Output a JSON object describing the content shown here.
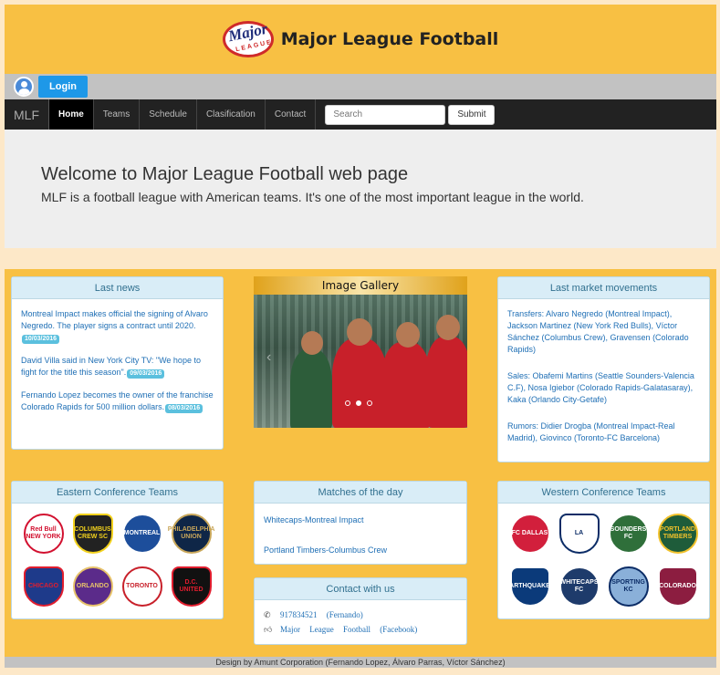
{
  "header": {
    "title": "Major League Football",
    "logo_word": "Major",
    "logo_sub": "LEAGUE"
  },
  "loginbar": {
    "login_label": "Login"
  },
  "nav": {
    "brand": "MLF",
    "items": [
      {
        "label": "Home",
        "active": true
      },
      {
        "label": "Teams"
      },
      {
        "label": "Schedule"
      },
      {
        "label": "Clasification"
      },
      {
        "label": "Contact"
      }
    ],
    "search_placeholder": "Search",
    "submit_label": "Submit"
  },
  "jumbotron": {
    "heading": "Welcome to Major League Football web page",
    "text": "MLF is a football league with American teams. It's one of the most important league in the world."
  },
  "last_news": {
    "title": "Last news",
    "items": [
      {
        "text": "Montreal Impact makes official the signing of Alvaro Negredo. The player signs a contract until 2020.",
        "date": "10/03/2016"
      },
      {
        "text": "David Villa said in New York City TV: \"We hope to fight for the title this season\".",
        "date": "09/03/2016"
      },
      {
        "text": "Fernando Lopez becomes the owner of the franchise Colorado Rapids for 500 million dollars.",
        "date": "08/03/2016"
      }
    ]
  },
  "gallery": {
    "title": "Image Gallery",
    "slides": 3,
    "active_slide": 2
  },
  "market": {
    "title": "Last market movements",
    "items": [
      "Transfers: Alvaro Negredo (Montreal Impact), Jackson Martinez (New York Red Bulls), Víctor Sánchez (Columbus Crew), Gravensen (Colorado Rapids)",
      "Sales: Obafemi Martins (Seattle Sounders-Valencia C.F), Nosa Igiebor (Colorado Rapids-Galatasaray), Kaka (Orlando City-Getafe)",
      "Rumors: Didier Drogba (Montreal Impact-Real Madrid), Giovinco (Toronto-FC Barcelona)"
    ]
  },
  "eastern": {
    "title": "Eastern Conference Teams",
    "teams": [
      {
        "name": "Red Bulls",
        "label": "Red Bull NEW YORK",
        "color": "#ffffff",
        "text": "#d2102f"
      },
      {
        "name": "Columbus Crew",
        "label": "COLUMBUS CREW SC",
        "color": "#222222",
        "text": "#f3d21d"
      },
      {
        "name": "Montreal Impact",
        "label": "MONTREAL",
        "color": "#1d4e9b",
        "text": "#ffffff"
      },
      {
        "name": "Philadelphia Union",
        "label": "PHILADELPHIA UNION",
        "color": "#0f2647",
        "text": "#c9a75a"
      },
      {
        "name": "Chicago Fire",
        "label": "CHICAGO",
        "color": "#1e3a8a",
        "text": "#e11d2e"
      },
      {
        "name": "Orlando City",
        "label": "ORLANDO",
        "color": "#5b2b8a",
        "text": "#e7c26a"
      },
      {
        "name": "Toronto FC",
        "label": "TORONTO",
        "color": "#ffffff",
        "text": "#c8202a"
      },
      {
        "name": "DC United",
        "label": "D.C. UNITED",
        "color": "#111111",
        "text": "#e11d2e"
      }
    ]
  },
  "matches": {
    "title": "Matches of the day",
    "items": [
      "Whitecaps-Montreal Impact",
      "Portland Timbers-Columbus Crew"
    ]
  },
  "contact": {
    "title": "Contact with us",
    "phone": "917834521   (Fernando)",
    "facebook": "Major League Football (Facebook)"
  },
  "western": {
    "title": "Western Conference Teams",
    "teams": [
      {
        "name": "FC Dallas",
        "label": "FC DALLAS",
        "color": "#d21f3c",
        "text": "#ffffff"
      },
      {
        "name": "LA Galaxy",
        "label": "LA",
        "color": "#ffffff",
        "text": "#0b2c66"
      },
      {
        "name": "Seattle Sounders",
        "label": "SOUNDERS FC",
        "color": "#2f6f3a",
        "text": "#ffffff"
      },
      {
        "name": "Portland Timbers",
        "label": "PORTLAND TIMBERS",
        "color": "#1e5c3a",
        "text": "#f1c12b"
      },
      {
        "name": "San Jose Earthquakes",
        "label": "EARTHQUAKES",
        "color": "#0b3a7a",
        "text": "#ffffff"
      },
      {
        "name": "Vancouver Whitecaps",
        "label": "WHITECAPS FC",
        "color": "#1e3b6b",
        "text": "#ffffff"
      },
      {
        "name": "Sporting KC",
        "label": "SPORTING KC",
        "color": "#8ab0d9",
        "text": "#0b2c66"
      },
      {
        "name": "Colorado Rapids",
        "label": "COLORADO",
        "color": "#8c1d40",
        "text": "#ffffff"
      }
    ]
  },
  "footer": {
    "text": "Design by Amunt Corporation (Fernando Lopez, Álvaro Parras, Víctor Sánchez)"
  }
}
